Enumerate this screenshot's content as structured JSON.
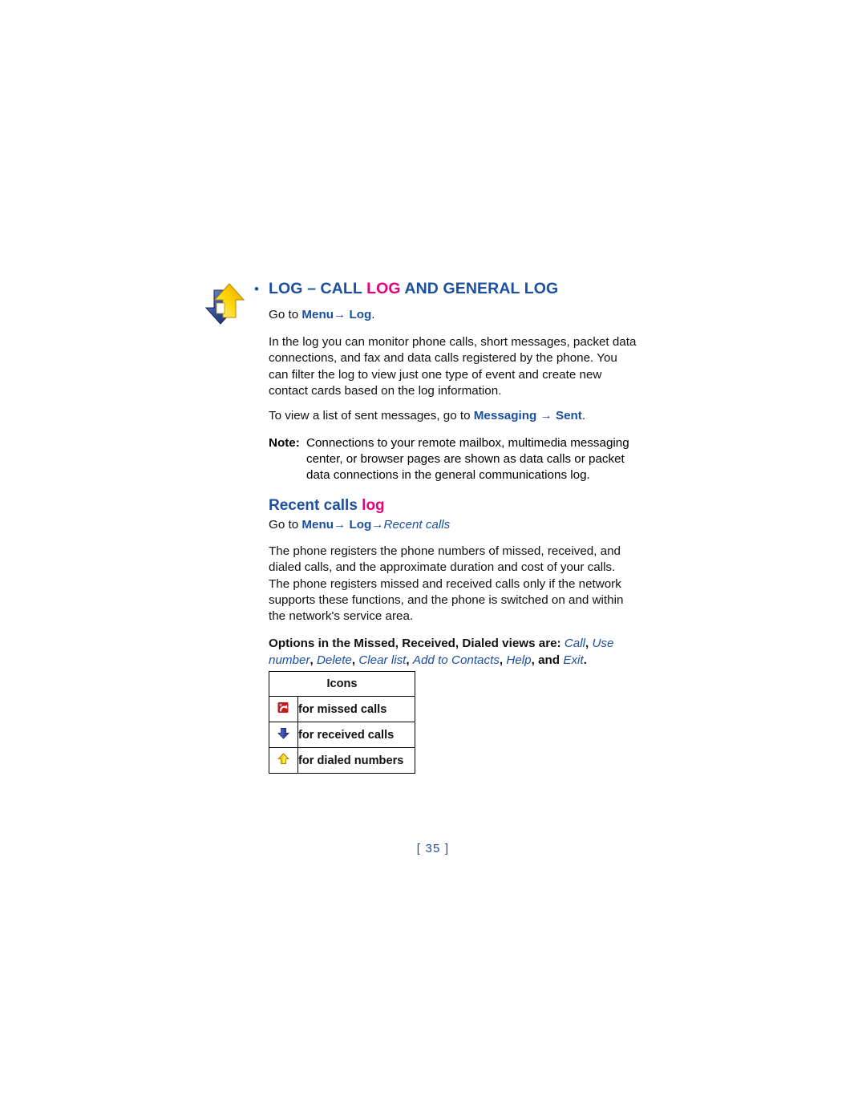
{
  "page": {
    "number_label": "[ 35 ]"
  },
  "section": {
    "icon_name": "log-arrows-icon",
    "bullet": "•",
    "title_part1": "LOG – CALL ",
    "title_highlight": "LOG",
    "title_part2": " AND GENERAL LOG",
    "nav": {
      "prefix": "Go to ",
      "item1": "Menu",
      "arrow1": "→",
      "item2": "Log",
      "suffix": "."
    },
    "intro_paragraph": "In the log you can monitor phone calls, short messages, packet data connections, and fax and data calls registered by the phone. You can filter the log to view just one type of event and create new contact cards based on the log information.",
    "sent_line": {
      "prefix": "To view a list of sent messages, go to ",
      "item1": "Messaging",
      "arrow1": "→",
      "item2": "Sent",
      "suffix": "."
    },
    "note": {
      "label": "Note:",
      "text": "Connections to your remote mailbox, multimedia messaging center, or browser pages are shown as data calls or packet data connections in the general communications log."
    }
  },
  "subsection": {
    "title_part1": "Recent calls ",
    "title_highlight": "log",
    "nav": {
      "prefix": "Go to ",
      "item1": "Menu",
      "arrow1": "→",
      "item2": "Log",
      "arrow2": "→",
      "item3": "Recent calls"
    },
    "paragraph": "The phone registers the phone numbers of missed, received, and dialed calls, and the approximate duration and cost of your calls.  The phone registers missed and received calls only if the network supports these functions, and the phone is switched on and within the network's service area.",
    "options": {
      "lead": "Options in the Missed, Received, Dialed views are: ",
      "items": [
        "Call",
        "Use number",
        "Delete",
        "Clear list",
        "Add to Contacts",
        "Help",
        "Exit"
      ],
      "separator": ", ",
      "conjunction": "and ",
      "terminator": "."
    }
  },
  "icons_table": {
    "header": "Icons",
    "rows": [
      {
        "icon_name": "missed-call-icon",
        "label": "for missed calls"
      },
      {
        "icon_name": "received-call-icon",
        "label": "for received calls"
      },
      {
        "icon_name": "dialed-number-icon",
        "label": "for dialed numbers"
      }
    ]
  },
  "colors": {
    "brand_blue": "#1b4fa0",
    "accent_magenta": "#e5007d",
    "missed_red": "#c00000",
    "received_blue": "#2b3f9e",
    "dialed_yellow": "#f2d400"
  }
}
